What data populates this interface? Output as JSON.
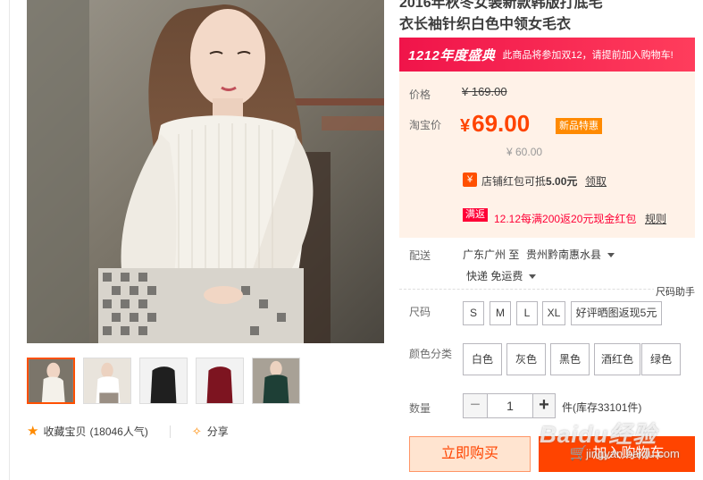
{
  "product": {
    "title_line1": "2016年秋冬女装新款韩版打底毛",
    "title_line2": "衣长袖针织白色中领女毛衣"
  },
  "banner": {
    "logo": "1212年度盛典",
    "promo": "此商品将参加双12，请提前加入购物车!",
    "color": "#f0144a"
  },
  "price": {
    "label": "价格",
    "original": "¥ 169.00",
    "taobao_label": "淘宝价",
    "sale_currency": "¥",
    "sale_value": "69.00",
    "new_tag": "新品特惠",
    "sub_price": "¥ 60.00"
  },
  "coupon": {
    "icon": "¥",
    "text_prefix": "店铺红包可抵",
    "amount": "5.00元",
    "link": "领取"
  },
  "rebate": {
    "tag": "满返",
    "text": "12.12每满200返20元现金红包",
    "link": "规则"
  },
  "shipping": {
    "label": "配送",
    "from": "广东广州 至",
    "to": "贵州黔南惠水县",
    "method": "快递 免运费"
  },
  "size": {
    "label": "尺码",
    "helper": "尺码助手",
    "options": [
      "S",
      "M",
      "L",
      "XL",
      "好评晒图返现5元"
    ]
  },
  "color": {
    "label": "颜色分类",
    "options": [
      "白色",
      "灰色",
      "黑色",
      "酒红色",
      "绿色"
    ]
  },
  "quantity": {
    "label": "数量",
    "minus": "−",
    "value": "1",
    "plus": "+",
    "stock": "件(库存33101件)"
  },
  "actions": {
    "buy_now": "立即购买",
    "add_to_cart": "加入购物车"
  },
  "favorites": {
    "label": "收藏宝贝",
    "count": "(18046人气)",
    "share": "分享"
  },
  "watermark": {
    "main": "Baidu经验",
    "sub": "jingyan.baidu.com"
  },
  "colors": {
    "accent": "#ff4400",
    "price_bg": "#fff2e8",
    "promo_red": "#ff0036"
  }
}
